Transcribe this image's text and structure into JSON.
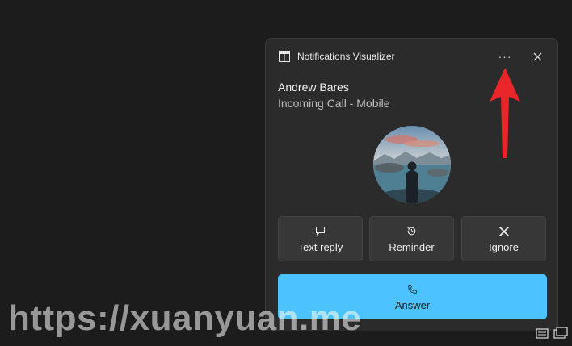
{
  "notification": {
    "app_name": "Notifications Visualizer",
    "app_icon": "windows-logo-icon",
    "more_label": "···",
    "close_icon": "close-icon",
    "title": "Andrew Bares",
    "subtitle": "Incoming Call - Mobile",
    "avatar": "profile-photo"
  },
  "actions": [
    {
      "label": "Text reply",
      "icon": "chat-bubble-icon"
    },
    {
      "label": "Reminder",
      "icon": "history-icon"
    },
    {
      "label": "Ignore",
      "icon": "close-icon"
    }
  ],
  "answer": {
    "label": "Answer",
    "icon": "phone-icon",
    "color": "#4cc2ff"
  },
  "watermark": "https://xuanyuan.me",
  "colors": {
    "background": "#1c1c1c",
    "toast": "#2b2b2b",
    "button": "#373737",
    "accent": "#4cc2ff",
    "arrow": "#e8262a"
  }
}
